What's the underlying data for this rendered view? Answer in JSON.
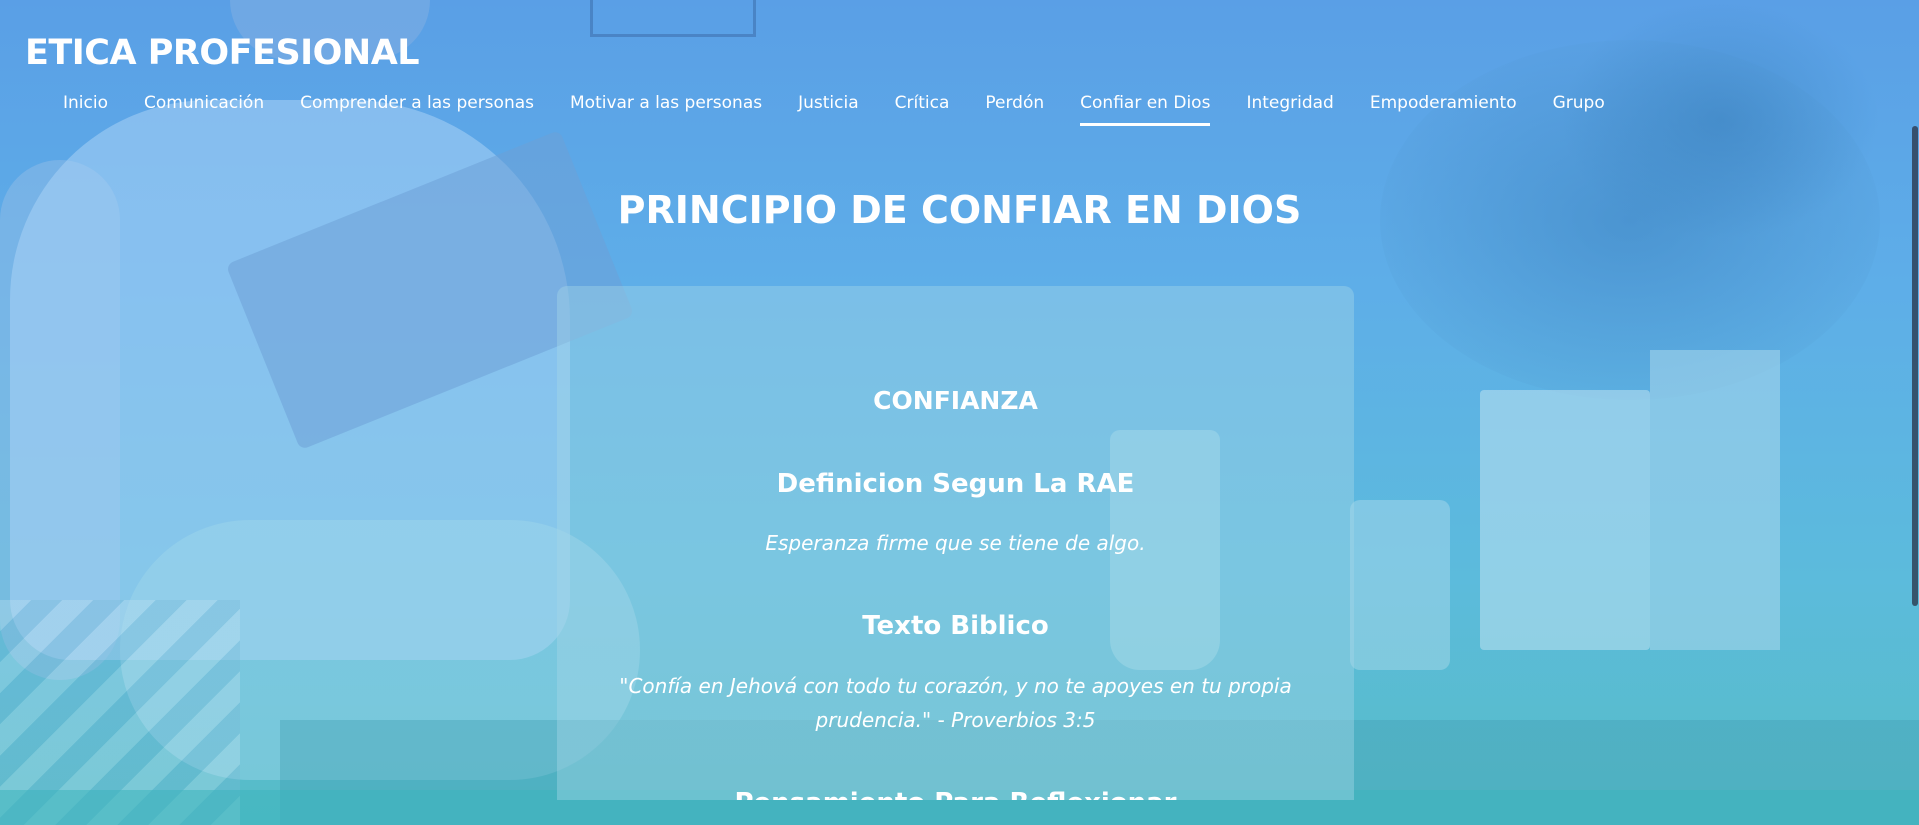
{
  "site": {
    "title": "ETICA PROFESIONAL"
  },
  "nav": {
    "items": [
      {
        "label": "Inicio",
        "active": false
      },
      {
        "label": "Comunicación",
        "active": false
      },
      {
        "label": "Comprender a las personas",
        "active": false
      },
      {
        "label": "Motivar a las personas",
        "active": false
      },
      {
        "label": "Justicia",
        "active": false
      },
      {
        "label": "Crítica",
        "active": false
      },
      {
        "label": "Perdón",
        "active": false
      },
      {
        "label": "Confiar en Dios",
        "active": true
      },
      {
        "label": "Integridad",
        "active": false
      },
      {
        "label": "Empoderamiento",
        "active": false
      },
      {
        "label": "Grupo",
        "active": false
      }
    ]
  },
  "main": {
    "heading": "PRINCIPIO DE CONFIAR EN DIOS",
    "card": {
      "section_title": "CONFIANZA",
      "definition_heading": "Definicion Segun La RAE",
      "definition_text": "Esperanza firme que se tiene de algo.",
      "bible_heading": "Texto Biblico",
      "bible_text": "\"Confía en Jehová con todo tu corazón, y no te apoyes en tu propia prudencia.\" - Proverbios 3:5",
      "reflection_heading": "Pensamiento Para Reflexionar"
    }
  },
  "colors": {
    "overlay_top": "#5a9fe6",
    "overlay_bottom": "#56bcc6",
    "text": "#ffffff"
  }
}
